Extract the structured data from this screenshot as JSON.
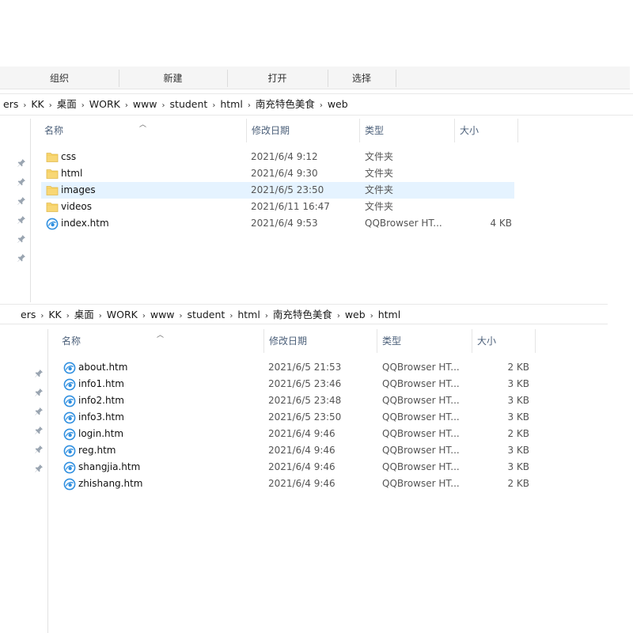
{
  "ribbon": {
    "groups": [
      "组织",
      "新建",
      "打开",
      "选择"
    ]
  },
  "pane1": {
    "breadcrumb": [
      "ers",
      "KK",
      "桌面",
      "WORK",
      "www",
      "student",
      "html",
      "南充特色美食",
      "web"
    ],
    "columns": {
      "name": "名称",
      "date": "修改日期",
      "type": "类型",
      "size": "大小"
    },
    "rows": [
      {
        "icon": "folder-icon",
        "name": "css",
        "date": "2021/6/4 9:12",
        "type": "文件夹",
        "size": ""
      },
      {
        "icon": "folder-icon",
        "name": "html",
        "date": "2021/6/4 9:30",
        "type": "文件夹",
        "size": ""
      },
      {
        "icon": "folder-icon",
        "name": "images",
        "date": "2021/6/5 23:50",
        "type": "文件夹",
        "size": "",
        "selected": true
      },
      {
        "icon": "folder-icon",
        "name": "videos",
        "date": "2021/6/11 16:47",
        "type": "文件夹",
        "size": ""
      },
      {
        "icon": "qqbrowser-file-icon",
        "name": "index.htm",
        "date": "2021/6/4 9:53",
        "type": "QQBrowser HT...",
        "size": "4 KB"
      }
    ]
  },
  "pane2": {
    "breadcrumb": [
      "ers",
      "KK",
      "桌面",
      "WORK",
      "www",
      "student",
      "html",
      "南充特色美食",
      "web",
      "html"
    ],
    "columns": {
      "name": "名称",
      "date": "修改日期",
      "type": "类型",
      "size": "大小"
    },
    "rows": [
      {
        "icon": "qqbrowser-file-icon",
        "name": "about.htm",
        "date": "2021/6/5 21:53",
        "type": "QQBrowser HT...",
        "size": "2 KB"
      },
      {
        "icon": "qqbrowser-file-icon",
        "name": "info1.htm",
        "date": "2021/6/5 23:46",
        "type": "QQBrowser HT...",
        "size": "3 KB"
      },
      {
        "icon": "qqbrowser-file-icon",
        "name": "info2.htm",
        "date": "2021/6/5 23:48",
        "type": "QQBrowser HT...",
        "size": "3 KB"
      },
      {
        "icon": "qqbrowser-file-icon",
        "name": "info3.htm",
        "date": "2021/6/5 23:50",
        "type": "QQBrowser HT...",
        "size": "3 KB"
      },
      {
        "icon": "qqbrowser-file-icon",
        "name": "login.htm",
        "date": "2021/6/4 9:46",
        "type": "QQBrowser HT...",
        "size": "2 KB"
      },
      {
        "icon": "qqbrowser-file-icon",
        "name": "reg.htm",
        "date": "2021/6/4 9:46",
        "type": "QQBrowser HT...",
        "size": "3 KB"
      },
      {
        "icon": "qqbrowser-file-icon",
        "name": "shangjia.htm",
        "date": "2021/6/4 9:46",
        "type": "QQBrowser HT...",
        "size": "3 KB"
      },
      {
        "icon": "qqbrowser-file-icon",
        "name": "zhishang.htm",
        "date": "2021/6/4 9:46",
        "type": "QQBrowser HT...",
        "size": "2 KB"
      }
    ]
  },
  "colors": {
    "selection": "#e5f3ff",
    "header_text": "#4c607a",
    "folder_yellow": "#f8d775",
    "qq_blue": "#2f8fe0"
  }
}
